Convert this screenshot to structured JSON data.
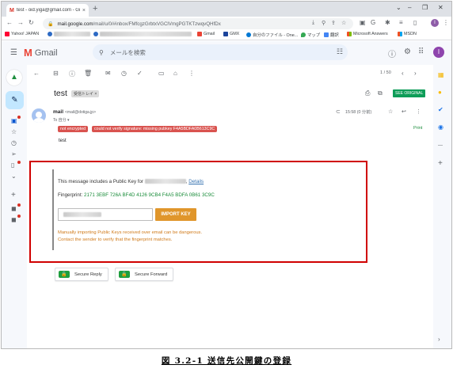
{
  "browser": {
    "tab_title": "test - oid.yiga@gmail.com - Gm...",
    "tab_favicon": "M",
    "tab_close": "×",
    "new_tab": "+",
    "window_controls": [
      "⌄",
      "–",
      "❐",
      "✕"
    ],
    "nav": [
      "←",
      "→",
      "↻"
    ],
    "url_lock": "🔒",
    "url_domain": "mail.google.com",
    "url_path": "/mail/u/0/#inbox/FMfcgzGrbtxVGClVmgPGTKTzwqvQHfDx",
    "omnibox_icons": [
      "⤓",
      "⚲",
      "⇪",
      "☆"
    ],
    "extension_icons": [
      "▣",
      "G",
      "✱",
      "≡",
      "▯"
    ],
    "profile_initial": "I",
    "menu": "⋮"
  },
  "bookmarks": [
    {
      "label": "Yahoo! JAPAN",
      "color": "#ff0033",
      "blurred": false
    },
    {
      "label": "",
      "color": "#2d6ac4",
      "blurred": true
    },
    {
      "label": "",
      "color": "#2d6ac4",
      "blurred": true
    },
    {
      "label": "Gmail",
      "color": "#ea4335",
      "blurred": false
    },
    {
      "label": "GMX",
      "color": "#1c449b",
      "blurred": false
    },
    {
      "label": "自分のファイル - One...",
      "color": "#0078d4",
      "blurred": false
    },
    {
      "label": "マップ",
      "color": "#34a853",
      "blurred": false
    },
    {
      "label": "翻訳",
      "color": "#4285f4",
      "blurred": false
    },
    {
      "label": "Microsoft Answers",
      "color": "#f25022",
      "blurred": false
    },
    {
      "label": "MSDN",
      "color": "#f25022",
      "blurred": false
    }
  ],
  "gmail_header": {
    "logo_text": "Gmail",
    "search_placeholder": "メールを検索",
    "search_icon": "🔍",
    "tune_icon": "⚙",
    "help_icon": "?",
    "settings_icon": "⚙",
    "apps_icon": "⠿",
    "avatar_initial": "I"
  },
  "toolbar": {
    "pager": "1 / 50"
  },
  "message": {
    "subject": "test",
    "label_chip": "受信トレイ ×",
    "see_original": "SEE ORIGINAL",
    "sender_name": "mail",
    "sender_email": "<mail@dotiga.jp>",
    "to_me": "To 自分 ▾",
    "time": "15:58 (0 分前)",
    "badge_not_encrypted": "not encrypted",
    "badge_signature": "could not verify signature: missing pubkey F4A5BDFA0B613C9C",
    "print_link": "Print",
    "body": "test"
  },
  "pubkey": {
    "intro": "This message includes a Public Key for",
    "details_link": "Details",
    "fingerprint_label": "Fingerprint:",
    "fingerprint_value": "2171 3EBF 726A BF4D 4126 9CB4 F4A5 BDFA 0B61 3C9C",
    "import_button": "IMPORT KEY",
    "warning_line1": "Manually importing Public Keys received over email can be dangerous.",
    "warning_line2": "Contact the sender to verify that the fingerprint matches."
  },
  "secure_buttons": {
    "reply": "Secure Reply",
    "forward": "Secure Forward"
  },
  "caption": "図 3.2-1 送信先公開鍵の登録",
  "colors": {
    "highlight_box": "#d00000",
    "import_button": "#e0962b",
    "badge_red": "#d9534f",
    "see_original": "#0e9d58",
    "fingerprint_green": "#1a8c3a"
  }
}
